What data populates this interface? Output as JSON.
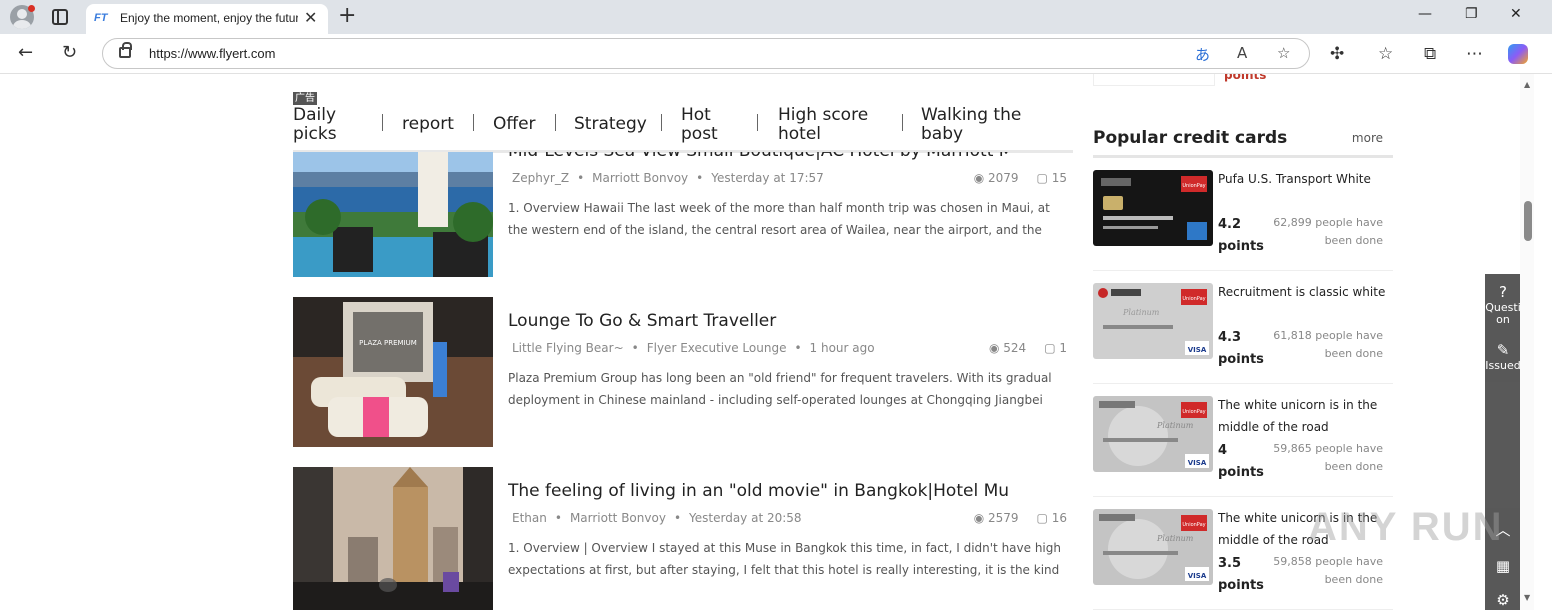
{
  "browser": {
    "tab_icon_text": "FT",
    "tab_title": "Enjoy the moment, enjoy the future",
    "url": "https://www.flyert.com",
    "window_controls": [
      "minimize-icon",
      "maximize-icon",
      "close-icon"
    ],
    "url_icons": [
      "translate-icon",
      "read-aloud-icon",
      "favorite-star-icon"
    ],
    "toolbar_icons": [
      "extensions-icon",
      "favorites-icon",
      "collections-icon",
      "more-icon",
      "copilot-icon"
    ]
  },
  "ad_label": "广告",
  "category_nav": [
    {
      "label": "Daily\npicks"
    },
    {
      "label": "report"
    },
    {
      "label": "Offer"
    },
    {
      "label": "Strategy"
    },
    {
      "label": "Hot\npost"
    },
    {
      "label": "High score\nhotel"
    },
    {
      "label": "Walking the\nbaby"
    }
  ],
  "articles": [
    {
      "title": "Mid-Levels Sea View Small Boutique|AC Hotel by Marriott Maui",
      "author": "Zephyr_Z",
      "forum": "Marriott Bonvoy",
      "time": "Yesterday at 17:57",
      "views": "2079",
      "comments": "15",
      "desc": "1. Overview Hawaii The last week of the more than half month trip was chosen in Maui, at the western end of the island, the central resort area of Wailea, near the airport, and the easternmost"
    },
    {
      "title": "Lounge To Go & Smart Traveller",
      "author": "Little Flying Bear~",
      "forum": "Flyer Executive Lounge",
      "time": "1 hour ago",
      "views": "524",
      "comments": "1",
      "desc": "Plaza Premium Group has long been an \"old friend\" for frequent travelers. With its gradual deployment in Chinese mainland - including self-operated lounges at Chongqing Jiangbei International"
    },
    {
      "title": "The feeling of living in an \"old movie\" in Bangkok|Hotel Muse...",
      "author": "Ethan",
      "forum": "Marriott Bonvoy",
      "time": "Yesterday at 20:58",
      "views": "2579",
      "comments": "16",
      "desc": "1. Overview | Overview I stayed at this Muse in Bangkok this time, in fact, I didn't have high expectations at first, but after staying, I felt that this hotel is really interesting, it is the kind of hotel"
    }
  ],
  "sidebar": {
    "top_points": "points",
    "heading": "Popular credit cards",
    "more": "more",
    "cards": [
      {
        "name": "Pufa U.S. Transport White",
        "score": "4.2\npoints",
        "people": "62,899 people have been done"
      },
      {
        "name": "Recruitment is classic white",
        "score": "4.3\npoints",
        "people": "61,818 people have been done"
      },
      {
        "name": "The white unicorn is in the middle of the road",
        "score": "4\npoints",
        "people": "59,865 people have been done"
      },
      {
        "name": "The white unicorn is in the middle of the road",
        "score": "3.5\npoints",
        "people": "59,858 people have been done"
      }
    ]
  },
  "float_bar": {
    "question": "Question",
    "issued": "Issued"
  },
  "card_texts": {
    "unionpay": "UnionPay",
    "visa": "VISA",
    "platinum": "Platinum"
  },
  "thumb_texts": {
    "plaza": "PLAZA PREMIUM"
  },
  "watermark": "ANY RUN"
}
